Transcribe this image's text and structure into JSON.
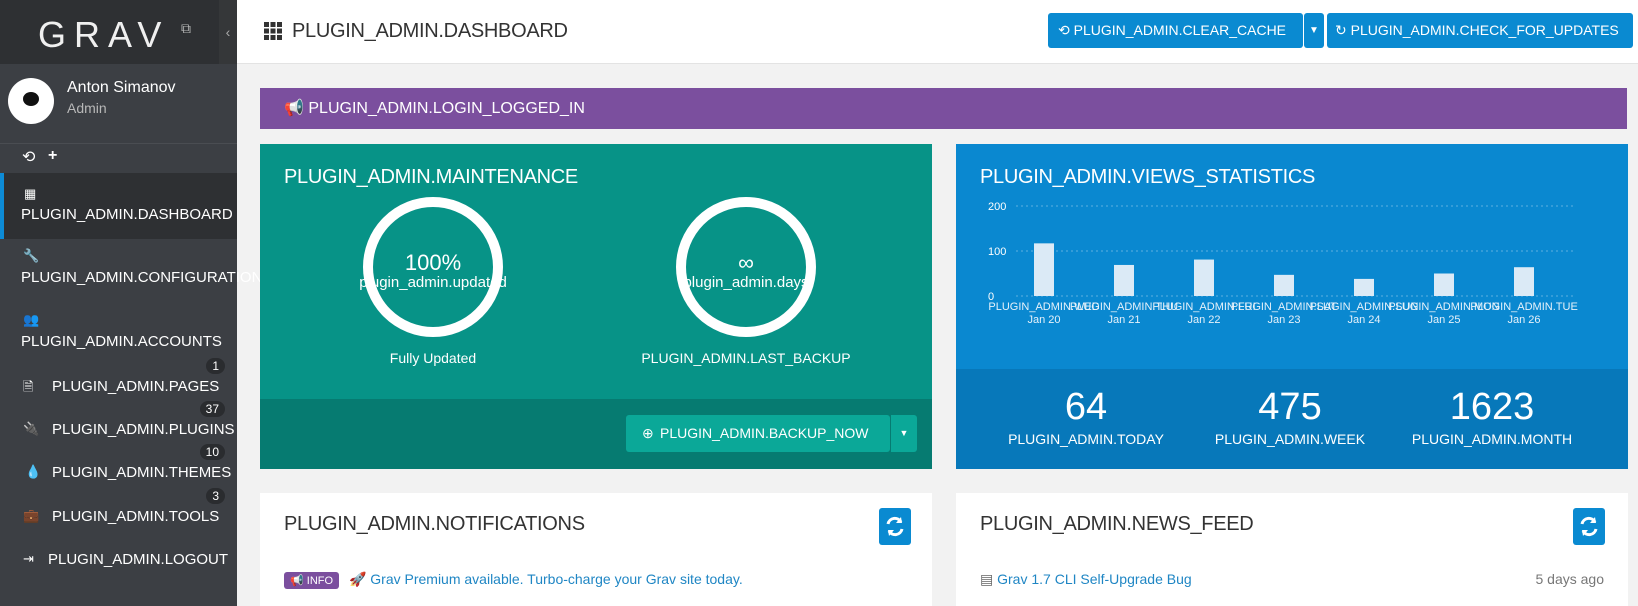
{
  "sidebar": {
    "logo": "GRAV",
    "user_name": "Anton Simanov",
    "user_role": "Admin",
    "items": [
      {
        "label": "PLUGIN_ADMIN.DASHBOARD"
      },
      {
        "label": "PLUGIN_ADMIN.CONFIGURATION"
      },
      {
        "label": "PLUGIN_ADMIN.ACCOUNTS",
        "badge": "1"
      },
      {
        "label": "PLUGIN_ADMIN.PAGES",
        "badge": "37"
      },
      {
        "label": "PLUGIN_ADMIN.PLUGINS",
        "badge": "10"
      },
      {
        "label": "PLUGIN_ADMIN.THEMES",
        "badge": "3"
      },
      {
        "label": "PLUGIN_ADMIN.TOOLS"
      },
      {
        "label": "PLUGIN_ADMIN.LOGOUT"
      }
    ]
  },
  "header": {
    "title": "PLUGIN_ADMIN.DASHBOARD",
    "clear_cache": "PLUGIN_ADMIN.CLEAR_CACHE",
    "check_updates": "PLUGIN_ADMIN.CHECK_FOR_UPDATES"
  },
  "alert": {
    "text": "PLUGIN_ADMIN.LOGIN_LOGGED_IN"
  },
  "maintenance": {
    "title": "PLUGIN_ADMIN.MAINTENANCE",
    "updated_value": "100%",
    "updated_label": "plugin_admin.updated",
    "updated_caption": "Fully Updated",
    "backup_value": "∞",
    "backup_label": "plugin_admin.days",
    "backup_caption": "PLUGIN_ADMIN.LAST_BACKUP",
    "backup_button": "PLUGIN_ADMIN.BACKUP_NOW"
  },
  "views": {
    "title": "PLUGIN_ADMIN.VIEWS_STATISTICS",
    "today_value": "64",
    "today_label": "PLUGIN_ADMIN.TODAY",
    "week_value": "475",
    "week_label": "PLUGIN_ADMIN.WEEK",
    "month_value": "1623",
    "month_label": "PLUGIN_ADMIN.MONTH"
  },
  "chart_data": {
    "type": "bar",
    "categories": [
      "Jan 20",
      "Jan 21",
      "Jan 22",
      "Jan 23",
      "Jan 24",
      "Jan 25",
      "Jan 26"
    ],
    "day_labels": [
      "PLUGIN_ADMIN.WED",
      "PLUGIN_ADMIN.THU",
      "PLUGIN_ADMIN.FRI",
      "PLUGIN_ADMIN.SAT",
      "PLUGIN_ADMIN.SUN",
      "PLUGIN_ADMIN.MON",
      "PLUGIN_ADMIN.TUE"
    ],
    "values": [
      117,
      69,
      81,
      47,
      38,
      50,
      64
    ],
    "yticks": [
      "200",
      "100",
      "0"
    ],
    "ylim": [
      0,
      200
    ],
    "grid": true
  },
  "notifications": {
    "title": "PLUGIN_ADMIN.NOTIFICATIONS",
    "badge": "INFO",
    "message": "Grav Premium available. Turbo-charge your Grav site today."
  },
  "news": {
    "title": "PLUGIN_ADMIN.NEWS_FEED",
    "item": "Grav 1.7 CLI Self-Upgrade Bug",
    "time": "5 days ago"
  }
}
